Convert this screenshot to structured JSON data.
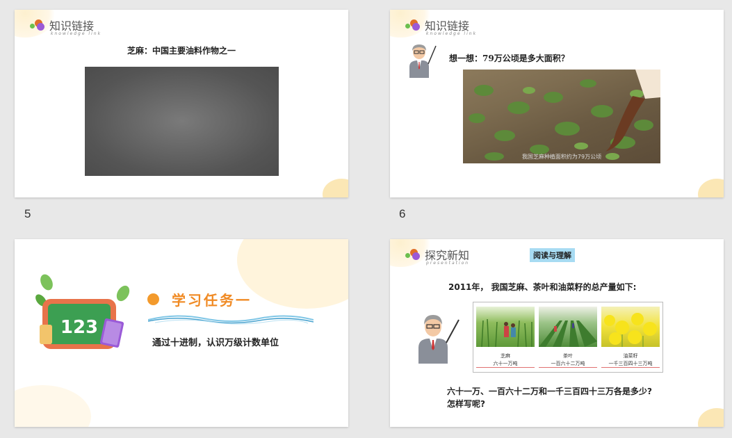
{
  "slides": [
    {
      "number": "5",
      "header": {
        "title": "知识链接",
        "subtitle": "knowledge link"
      },
      "caption": "芝麻：中国主要油料作物之一"
    },
    {
      "number": "6",
      "header": {
        "title": "知识链接",
        "subtitle": "knowledge link"
      },
      "question": "想一想：79万公顷是多大面积？",
      "photo_caption": "我国芝麻种植面积约为79万公顷"
    },
    {
      "title": "学习任务一",
      "subtitle": "通过十进制，认识万级计数单位",
      "board_text": "123"
    },
    {
      "header": {
        "title": "探究新知",
        "subtitle": "presentation"
      },
      "tag": "阅读与理解",
      "intro": "2011年， 我国芝麻、茶叶和油菜籽的总产量如下:",
      "crops": [
        {
          "name": "芝麻",
          "value": "六十一万吨"
        },
        {
          "name": "茶叶",
          "value": "一百六十二万吨"
        },
        {
          "name": "油菜籽",
          "value": "一千三百四十三万吨"
        }
      ],
      "question_line1": "六十一万、一百六十二万和一千三百四十三万各是多少?",
      "question_line2": "怎样写呢?"
    }
  ],
  "colors": {
    "accent": "#f08a24",
    "tag_bg": "#a7dbf2",
    "corner": "#fbe7b5"
  }
}
